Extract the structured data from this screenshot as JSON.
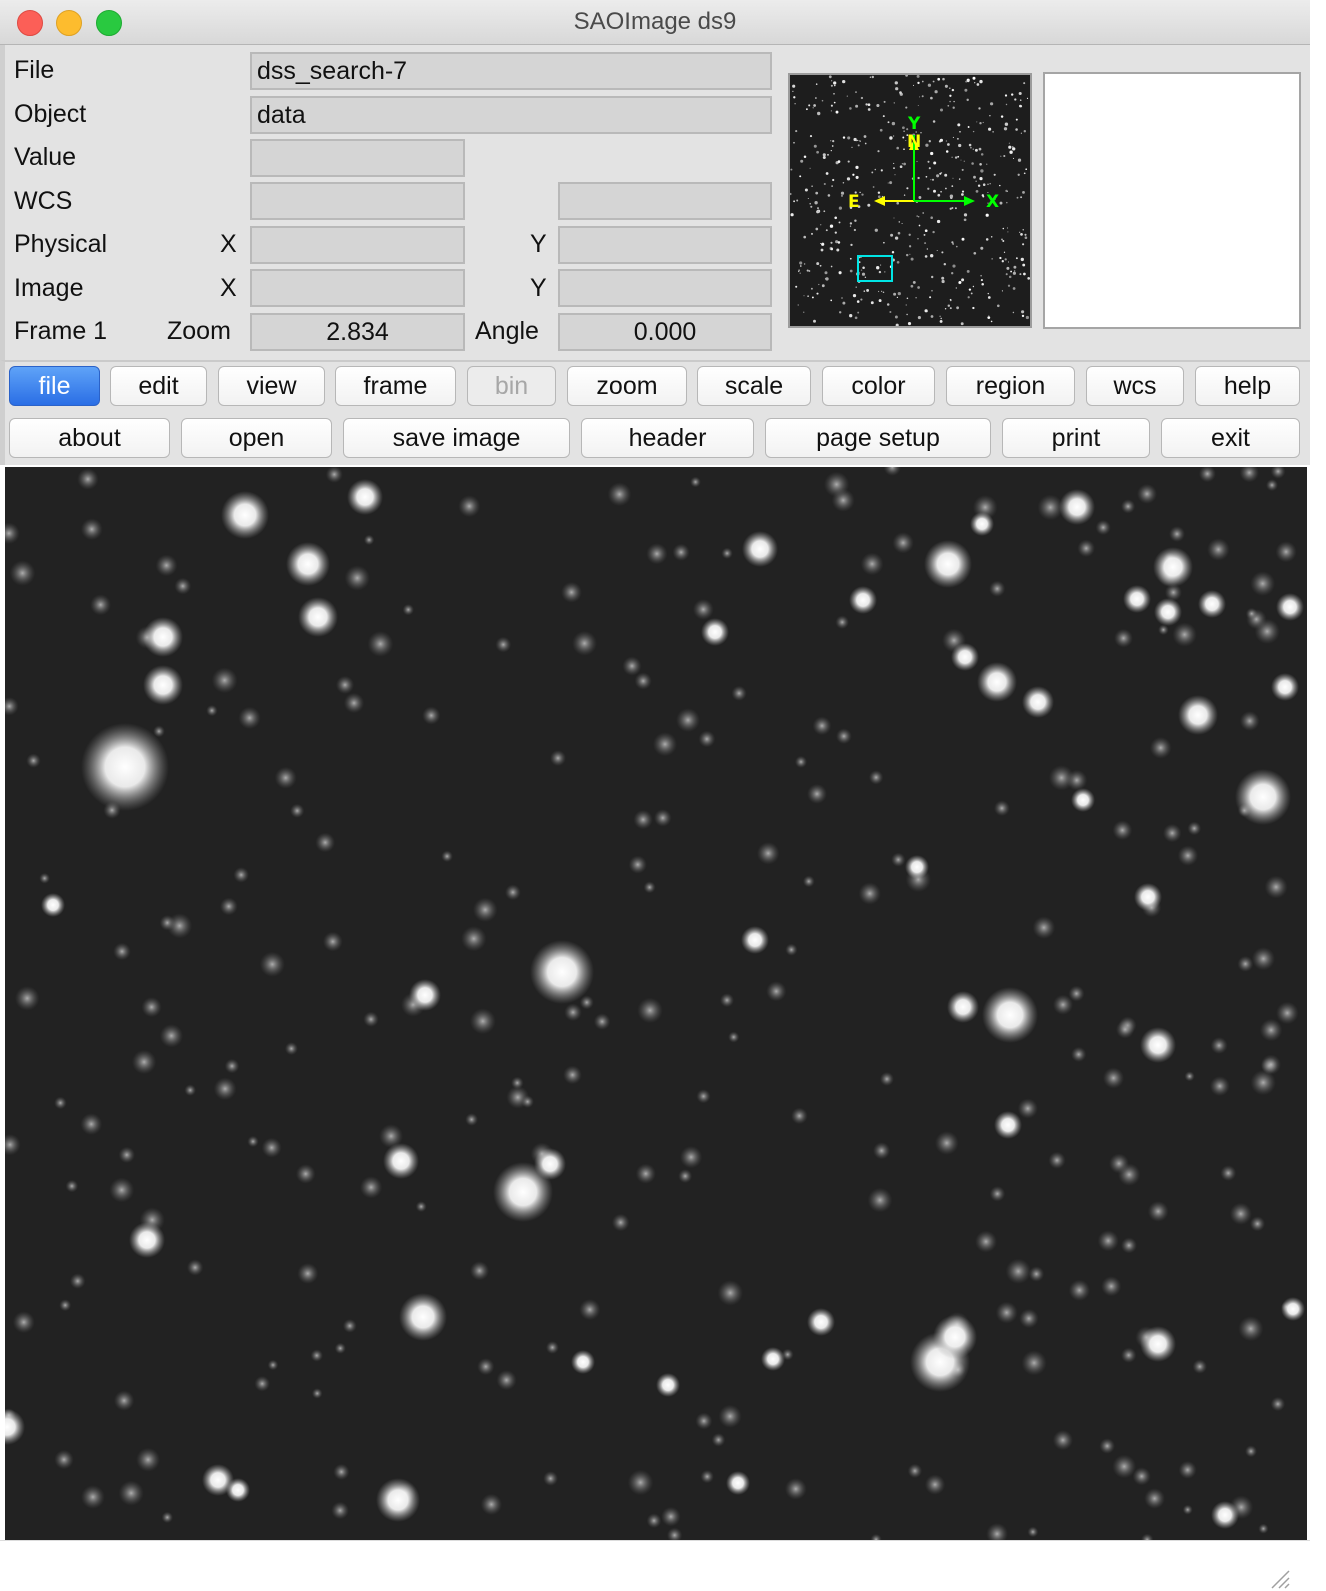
{
  "window": {
    "title": "SAOImage ds9"
  },
  "info": {
    "file_label": "File",
    "file_value": "dss_search-7",
    "object_label": "Object",
    "object_value": "data",
    "value_label": "Value",
    "value_value": "",
    "wcs_label": "WCS",
    "wcs_value1": "",
    "wcs_value2": "",
    "physical_label": "Physical",
    "physical_x_label": "X",
    "physical_x_value": "",
    "physical_y_label": "Y",
    "physical_y_value": "",
    "image_label": "Image",
    "image_x_label": "X",
    "image_x_value": "",
    "image_y_label": "Y",
    "image_y_value": "",
    "frame_label": "Frame 1",
    "zoom_label": "Zoom",
    "zoom_value": "2.834",
    "angle_label": "Angle",
    "angle_value": "0.000"
  },
  "panner": {
    "compass_n": "N",
    "compass_e": "E",
    "axis_x": "X",
    "axis_y": "Y",
    "compass_color": "#ffff00",
    "axis_color": "#00ff00",
    "view_box_color": "#00e5e5"
  },
  "menu": {
    "buttons": [
      "file",
      "edit",
      "view",
      "frame",
      "bin",
      "zoom",
      "scale",
      "color",
      "region",
      "wcs",
      "help"
    ],
    "active": "file",
    "disabled": "bin"
  },
  "file_buttons": [
    "about",
    "open",
    "save image",
    "header",
    "page setup",
    "print",
    "exit"
  ]
}
